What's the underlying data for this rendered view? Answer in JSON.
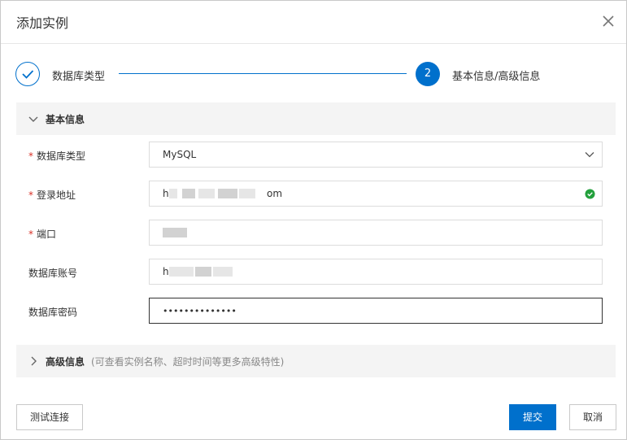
{
  "dialog": {
    "title": "添加实例"
  },
  "steps": [
    {
      "label": "数据库类型",
      "status": "done"
    },
    {
      "number": "2",
      "label": "基本信息/高级信息",
      "status": "active"
    }
  ],
  "basic": {
    "title": "基本信息",
    "fields": {
      "db_type": {
        "label": "数据库类型",
        "required": true,
        "value": "MySQL"
      },
      "address": {
        "label": "登录地址",
        "required": true,
        "value_start": "h",
        "value_end": "om",
        "valid": true
      },
      "port": {
        "label": "端口",
        "required": true
      },
      "account": {
        "label": "数据库账号",
        "required": false,
        "value_start": "h"
      },
      "password": {
        "label": "数据库密码",
        "required": false,
        "value": "••••••••••••••"
      }
    }
  },
  "advanced": {
    "title": "高级信息",
    "hint": "(可查看实例名称、超时时间等更多高级特性)"
  },
  "footer": {
    "test_label": "测试连接",
    "submit_label": "提交",
    "cancel_label": "取消"
  },
  "colors": {
    "primary": "#0070cc",
    "required": "#d93026",
    "success": "#23a03c"
  },
  "icons": {
    "close": "close-icon",
    "step_done": "check-icon",
    "expand": "chevron-down-icon",
    "collapse": "chevron-right-icon",
    "valid": "check-circle-icon"
  }
}
